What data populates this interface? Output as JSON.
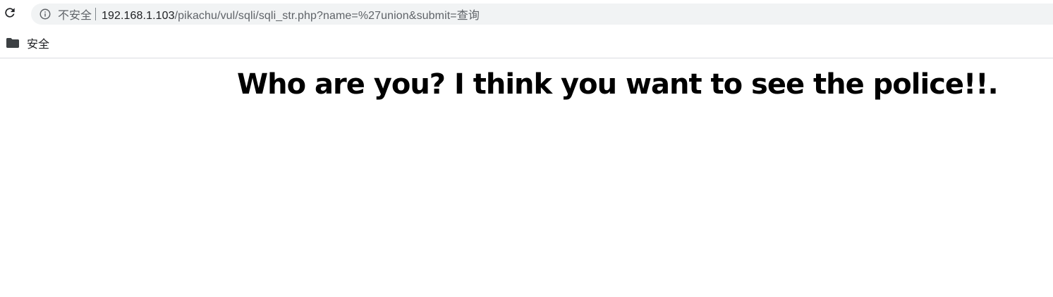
{
  "browser": {
    "security_label": "不安全",
    "url": {
      "host": "192.168.1.103",
      "path": "/pikachu/vul/sqli/sqli_str.php?name=%27union&submit=查询"
    },
    "icons": {
      "reload": "reload-icon",
      "info": "info-icon",
      "folder": "folder-icon"
    }
  },
  "bookmarks": {
    "items": [
      {
        "label": "安全"
      }
    ]
  },
  "page": {
    "message": "Who are you? I think you want to see the police!!."
  }
}
